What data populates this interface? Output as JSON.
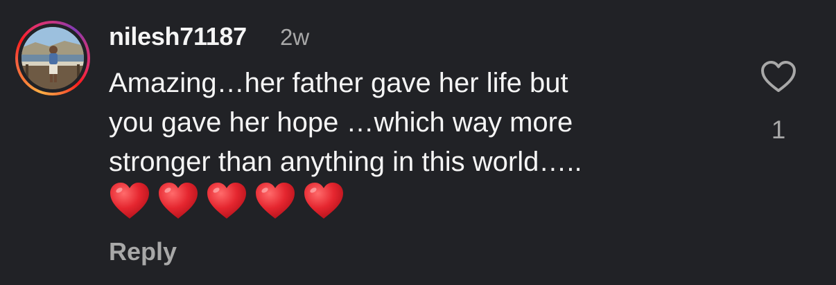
{
  "comment": {
    "username": "nilesh71187",
    "timestamp": "2w",
    "text_lines": [
      "Amazing…her father gave her life but",
      "you gave her hope …which way more",
      "stronger than anything in this world….."
    ],
    "emojis": [
      "red-heart-emoji",
      "red-heart-emoji",
      "red-heart-emoji",
      "red-heart-emoji",
      "red-heart-emoji"
    ],
    "reply_label": "Reply",
    "like_icon": "heart-outline-icon",
    "like_count": "1"
  },
  "colors": {
    "background": "#212226",
    "primary_text": "#f5f5f5",
    "secondary_text": "#a8a8a8",
    "heart_emoji": "#e0242e"
  }
}
